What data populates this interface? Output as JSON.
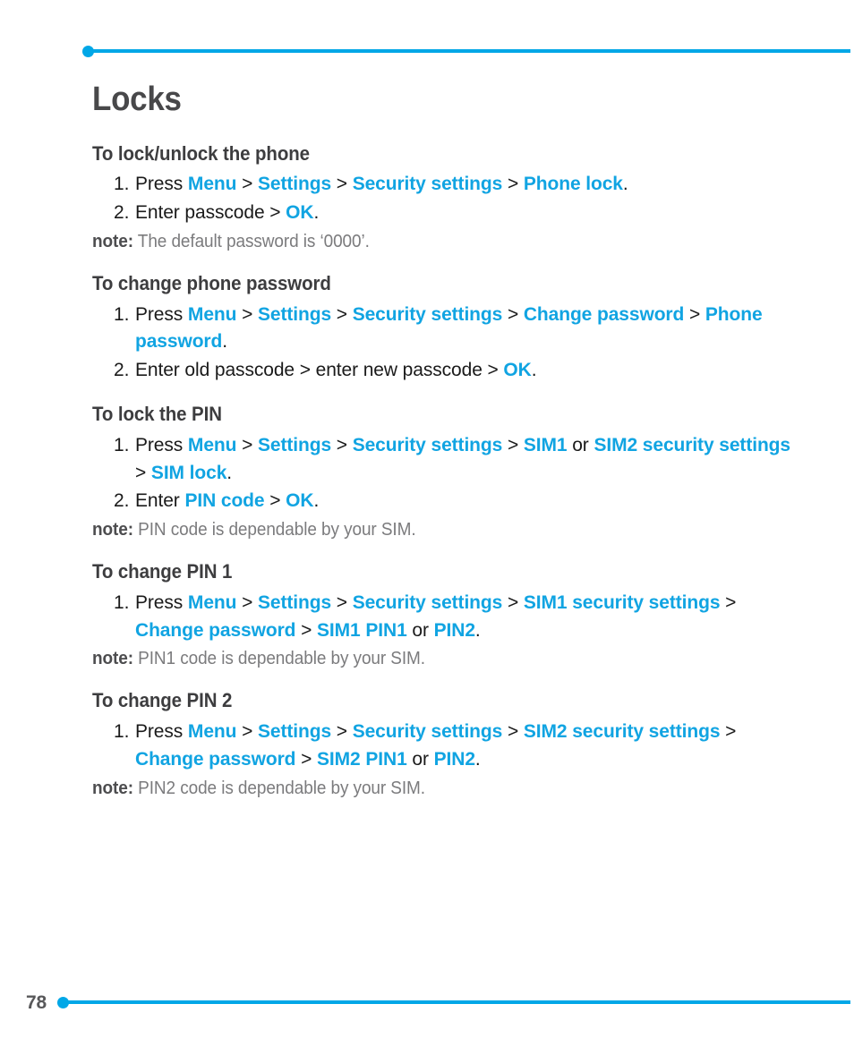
{
  "colors": {
    "accent": "#00a7e7",
    "link": "#11a4e2",
    "title": "#48484a",
    "heading": "#3d3d3f",
    "body": "#1a1a1a",
    "note": "#7b7b7d",
    "page_number": "#58585a"
  },
  "header": {
    "rule_dot": "rule-dot-icon",
    "rule_line": "rule-line"
  },
  "footer": {
    "page_number": "78",
    "rule_dot": "rule-dot-icon",
    "rule_line": "rule-line"
  },
  "page": {
    "title": "Locks"
  },
  "sections": [
    {
      "heading": "To lock/unlock the phone",
      "steps": [
        {
          "marker": "1.",
          "parts": [
            {
              "text": "Press ",
              "style": "plain"
            },
            {
              "text": "Menu",
              "style": "hl"
            },
            {
              "text": " > ",
              "style": "sep"
            },
            {
              "text": "Settings",
              "style": "hl"
            },
            {
              "text": " > ",
              "style": "sep"
            },
            {
              "text": "Security settings",
              "style": "hl"
            },
            {
              "text": " > ",
              "style": "sep"
            },
            {
              "text": "Phone lock",
              "style": "hl"
            },
            {
              "text": ".",
              "style": "plain"
            }
          ]
        },
        {
          "marker": "2.",
          "parts": [
            {
              "text": "Enter passcode > ",
              "style": "plain"
            },
            {
              "text": "OK",
              "style": "hl"
            },
            {
              "text": ".",
              "style": "plain"
            }
          ]
        }
      ],
      "note": {
        "label": "note:",
        "text": " The default password is ‘0000’."
      }
    },
    {
      "heading": "To change phone password",
      "steps": [
        {
          "marker": "1.",
          "parts": [
            {
              "text": "Press ",
              "style": "plain"
            },
            {
              "text": "Menu",
              "style": "hl"
            },
            {
              "text": " > ",
              "style": "sep"
            },
            {
              "text": "Settings",
              "style": "hl"
            },
            {
              "text": " > ",
              "style": "sep"
            },
            {
              "text": "Security settings",
              "style": "hl"
            },
            {
              "text": " > ",
              "style": "sep"
            },
            {
              "text": "Change password",
              "style": "hl"
            },
            {
              "text": " > ",
              "style": "sep"
            },
            {
              "text": "Phone password",
              "style": "hl"
            },
            {
              "text": ".",
              "style": "plain"
            }
          ]
        },
        {
          "marker": "2.",
          "parts": [
            {
              "text": "Enter old passcode > enter new passcode > ",
              "style": "plain"
            },
            {
              "text": "OK",
              "style": "hl"
            },
            {
              "text": ".",
              "style": "plain"
            }
          ]
        }
      ],
      "note": null
    },
    {
      "heading": "To lock the PIN",
      "steps": [
        {
          "marker": "1.",
          "parts": [
            {
              "text": "Press ",
              "style": "plain"
            },
            {
              "text": "Menu",
              "style": "hl"
            },
            {
              "text": " > ",
              "style": "sep"
            },
            {
              "text": "Settings",
              "style": "hl"
            },
            {
              "text": " > ",
              "style": "sep"
            },
            {
              "text": "Security settings",
              "style": "hl"
            },
            {
              "text": " > ",
              "style": "sep"
            },
            {
              "text": "SIM1",
              "style": "hl"
            },
            {
              "text": " or ",
              "style": "plain"
            },
            {
              "text": "SIM2 security settings",
              "style": "hl"
            },
            {
              "text": " > ",
              "style": "sep"
            },
            {
              "text": "SIM lock",
              "style": "hl"
            },
            {
              "text": ".",
              "style": "plain"
            }
          ]
        },
        {
          "marker": "2.",
          "parts": [
            {
              "text": "Enter ",
              "style": "plain"
            },
            {
              "text": "PIN code",
              "style": "hl"
            },
            {
              "text": " > ",
              "style": "sep"
            },
            {
              "text": "OK",
              "style": "hl"
            },
            {
              "text": ".",
              "style": "plain"
            }
          ]
        }
      ],
      "note": {
        "label": "note:",
        "text": " PIN code is dependable by your SIM."
      }
    },
    {
      "heading": "To change PIN 1",
      "steps": [
        {
          "marker": "1.",
          "parts": [
            {
              "text": "Press ",
              "style": "plain"
            },
            {
              "text": "Menu",
              "style": "hl"
            },
            {
              "text": " > ",
              "style": "sep"
            },
            {
              "text": "Settings",
              "style": "hl"
            },
            {
              "text": " > ",
              "style": "sep"
            },
            {
              "text": "Security settings",
              "style": "hl"
            },
            {
              "text": " > ",
              "style": "sep"
            },
            {
              "text": "SIM1 security settings",
              "style": "hl"
            },
            {
              "text": " > ",
              "style": "sep"
            },
            {
              "text": "Change password",
              "style": "hl"
            },
            {
              "text": " > ",
              "style": "sep"
            },
            {
              "text": "SIM1 PIN1",
              "style": "hl"
            },
            {
              "text": " or ",
              "style": "plain"
            },
            {
              "text": "PIN2",
              "style": "hl"
            },
            {
              "text": ".",
              "style": "plain"
            }
          ]
        }
      ],
      "note": {
        "label": "note:",
        "text": " PIN1 code is dependable by your SIM."
      }
    },
    {
      "heading": "To change PIN 2",
      "steps": [
        {
          "marker": "1.",
          "parts": [
            {
              "text": "Press ",
              "style": "plain"
            },
            {
              "text": "Menu",
              "style": "hl"
            },
            {
              "text": " > ",
              "style": "sep"
            },
            {
              "text": "Settings",
              "style": "hl"
            },
            {
              "text": " > ",
              "style": "sep"
            },
            {
              "text": "Security settings",
              "style": "hl"
            },
            {
              "text": " > ",
              "style": "sep"
            },
            {
              "text": "SIM2 security settings",
              "style": "hl"
            },
            {
              "text": " > ",
              "style": "sep"
            },
            {
              "text": "Change password",
              "style": "hl"
            },
            {
              "text": " > ",
              "style": "sep"
            },
            {
              "text": "SIM2 PIN1",
              "style": "hl"
            },
            {
              "text": " or ",
              "style": "plain"
            },
            {
              "text": "PIN2",
              "style": "hl"
            },
            {
              "text": ".",
              "style": "plain"
            }
          ]
        }
      ],
      "note": {
        "label": "note:",
        "text": " PIN2 code is dependable by your SIM."
      }
    }
  ]
}
